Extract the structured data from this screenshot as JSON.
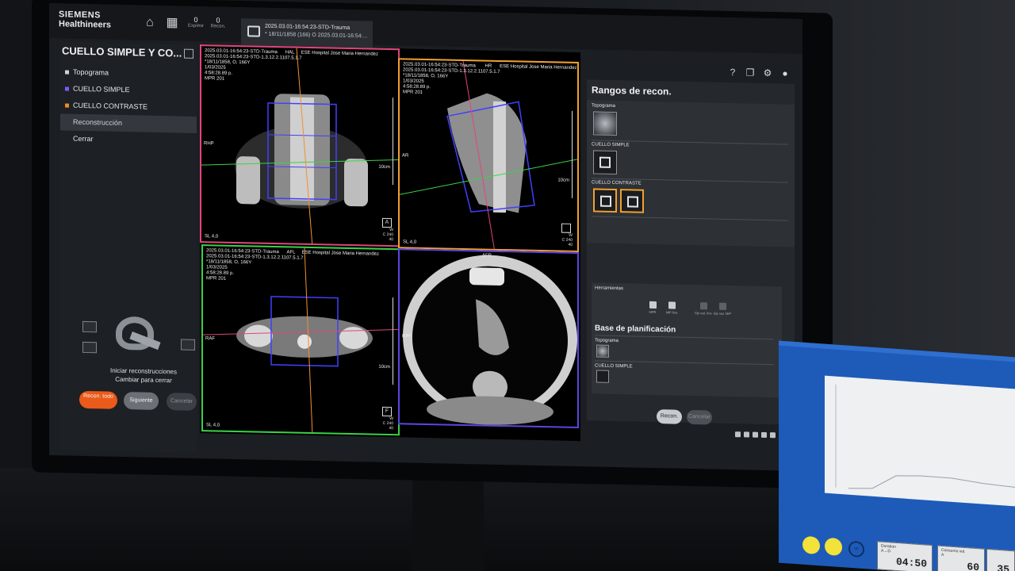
{
  "brand": {
    "line1": "SIEMENS",
    "line2": "Healthineers"
  },
  "topbar": {
    "stats": [
      {
        "value": "0",
        "caption": "Expimir"
      },
      {
        "value": "0",
        "caption": "Recon."
      }
    ],
    "task_tab": {
      "line1": "2025.03.01-16:54:23-STD-Trauma",
      "line2": "* 18/11/1858 (166) O 2025.03.01-16:54:..."
    }
  },
  "left_panel": {
    "title": "CUELLO SIMPLE Y CO...",
    "tree": [
      {
        "label": "Topograma",
        "swatch": "#cfd3d8"
      },
      {
        "label": "CUELLO SIMPLE",
        "swatch": "#7a5cff"
      },
      {
        "label": "CUELLO CONTRASTE",
        "swatch": "#f08a24"
      },
      {
        "label": "Reconstrucción",
        "selected": true
      },
      {
        "label": "Cerrar"
      }
    ],
    "status_line1": "Iniciar reconstrucciones",
    "status_line2": "Cambiar para cerrar",
    "buttons": {
      "recon_all": "Recon. todo",
      "next": "Siguiente",
      "cancel": "Cancelar"
    }
  },
  "viewports": [
    {
      "header": "2025.03.01-16:54:23-STD-Trauma      HAL     ESE Hospital Jose Maria Hernandez\n2025.03.01-16:54:23-STD-1.3.12.2.1107.5.1.7\n*18/11/1858, O, 166Y\n1/03/2025\n4:58:28.89 p.\nMPR 201",
      "orient_left": "RHP",
      "orient_top": "",
      "scale": "10cm",
      "slice": "SL 4,0",
      "wl": "W\nC",
      "wl_val": "240\n40",
      "icon": "A",
      "border": "#e0467a"
    },
    {
      "header": "2025.03.01-16:54:23-STD-Trauma       HR      ESE Hospital Jose Maria Hernandez\n2025.03.01-16:54:23-STD-1.3.12.2.1107.5.1.7\n*18/11/1858, O, 166Y\n1/03/2025\n4:58:28.89 p.\nMPR 201",
      "orient_left": "AR",
      "orient_top": "",
      "scale": "10cm",
      "slice": "SL 4,0",
      "wl": "W\nC",
      "wl_val": "240\n40",
      "icon": "",
      "border": "#f0a030"
    },
    {
      "header": "2025.03.01-16:54:23-STD-Trauma      AFL     ESE Hospital Jose Maria Hernandez\n2025.03.01-16:54:23-STD-1.3.12.2.1107.5.1.7\n*18/11/1858, O, 166Y\n1/03/2025\n4:58:28.89 p.\nMPR 201",
      "orient_left": "RAF",
      "orient_top": "",
      "scale": "10cm",
      "slice": "SL 4,0",
      "wl": "W\nC",
      "wl_val": "240\n40",
      "icon": "F",
      "border": "#38d24a"
    },
    {
      "header": "",
      "orient_left": "RPF",
      "orient_top": "AFR",
      "scale": "",
      "slice": "",
      "wl": "",
      "wl_val": "",
      "icon": "",
      "border": "#5a46e0"
    }
  ],
  "right_panel": {
    "title": "Rangos de recon.",
    "sections": [
      {
        "label": "Topograma"
      },
      {
        "label": "CUELLO SIMPLE"
      },
      {
        "label": "CUELLO CONTRASTE"
      }
    ],
    "tools_label": "Herramientas",
    "tools": [
      {
        "label": "MPR"
      },
      {
        "label": "MIP fina"
      },
      {
        "label": "Eje rad. fino"
      },
      {
        "label": "Eje rad. MIP"
      }
    ],
    "planning_title": "Base de planificación",
    "planning": [
      {
        "label": "Topograma"
      },
      {
        "label": "CUELLO SIMPLE"
      }
    ],
    "buttons": {
      "recon": "Recon.",
      "cancel": "Cancelar"
    }
  },
  "device": {
    "boxes": [
      {
        "caption": "Duration\nA→D",
        "value": "04:50"
      },
      {
        "caption": "Consumo vol.\nA",
        "value": "60"
      },
      {
        "caption": "",
        "value": "35"
      }
    ],
    "ring_label": "00"
  },
  "colors": {
    "accent_orange": "#ea5a1a",
    "series_simple": "#7a5cff",
    "series_contrast": "#f08a24"
  }
}
